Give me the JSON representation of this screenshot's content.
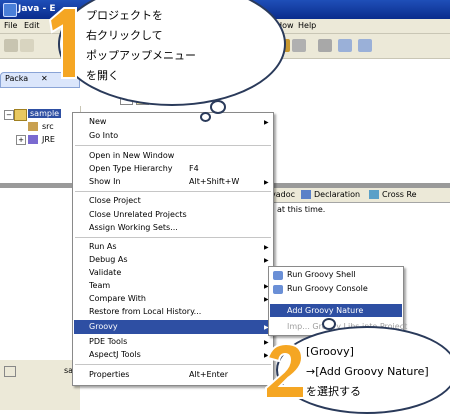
{
  "window": {
    "title": "Java - E"
  },
  "menubar": {
    "items": [
      "File",
      "Edit",
      "un",
      "Window",
      "Help"
    ]
  },
  "package_explorer": {
    "tab_label": "Packa",
    "tree": [
      {
        "label": "sample"
      },
      {
        "label": "src"
      },
      {
        "label": "JRE"
      }
    ]
  },
  "views": {
    "tabs": [
      "vadoc",
      "Declaration",
      "Cross Re"
    ],
    "message": "at this time."
  },
  "bottom_left": {
    "label": "sa"
  },
  "context_menu": {
    "items": [
      {
        "label": "New",
        "submenu": true
      },
      {
        "label": "Go Into"
      },
      {
        "label": "Open in New Window"
      },
      {
        "label": "Open Type Hierarchy",
        "shortcut": "F4"
      },
      {
        "label": "Show In",
        "shortcut": "Alt+Shift+W",
        "submenu": true
      },
      {
        "label": "Close Project"
      },
      {
        "label": "Close Unrelated Projects"
      },
      {
        "label": "Assign Working Sets..."
      },
      {
        "label": "Run As",
        "submenu": true
      },
      {
        "label": "Debug As",
        "submenu": true
      },
      {
        "label": "Validate"
      },
      {
        "label": "Team",
        "submenu": true
      },
      {
        "label": "Compare With",
        "submenu": true
      },
      {
        "label": "Restore from Local History..."
      },
      {
        "label": "Groovy",
        "submenu": true,
        "selected": true
      },
      {
        "label": "PDE Tools",
        "submenu": true
      },
      {
        "label": "AspectJ Tools",
        "submenu": true
      },
      {
        "label": "Properties",
        "shortcut": "Alt+Enter"
      }
    ]
  },
  "groovy_submenu": {
    "items": [
      {
        "label": "Run Groovy Shell",
        "icon": "groovy-run-icon"
      },
      {
        "label": "Run Groovy Console",
        "icon": "groovy-run-icon"
      },
      {
        "label": "Add Groovy Nature",
        "selected": true
      },
      {
        "label": "Imp... Groovy Libs into Project",
        "disabled": true
      }
    ]
  },
  "callouts": [
    {
      "number": "1",
      "lines": [
        "プロジェクトを",
        "右クリックして",
        "ポップアップメニュー",
        "を開く"
      ]
    },
    {
      "number": "2",
      "lines": [
        "[Groovy]",
        "→[Add Groovy Nature]",
        "を選択する"
      ]
    }
  ],
  "colors": {
    "selection": "#2e4fa3",
    "callout_number": "#f5a623",
    "titlebar": "#0a2c8c"
  }
}
